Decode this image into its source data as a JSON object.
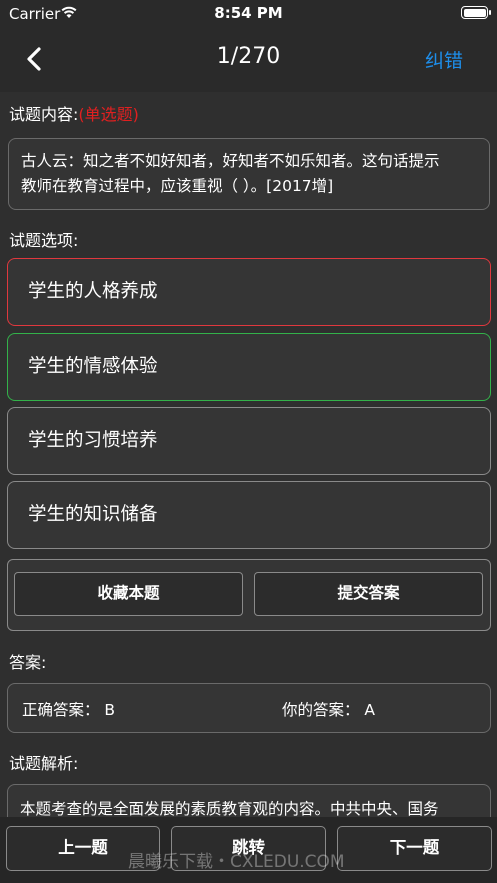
{
  "status_bar": {
    "carrier": "Carrier",
    "time": "8:54 PM"
  },
  "nav": {
    "title": "1/270",
    "correct_label": "纠错"
  },
  "question": {
    "section_label": "试题内容:",
    "type_tag": "(单选题)",
    "text_line1": "古人云：知之者不如好知者，好知者不如乐知者。这句话提示",
    "text_line2": "教师在教育过程中，应该重视（ ）。[2017增]"
  },
  "options": {
    "section_label": "试题选项:",
    "items": [
      {
        "label": "学生的人格养成",
        "state": "wrong"
      },
      {
        "label": "学生的情感体验",
        "state": "right"
      },
      {
        "label": "学生的习惯培养",
        "state": "none"
      },
      {
        "label": "学生的知识储备",
        "state": "none"
      }
    ]
  },
  "actions": {
    "favorite_label": "收藏本题",
    "submit_label": "提交答案"
  },
  "answer": {
    "section_label": "答案:",
    "correct_text": "正确答案：  B",
    "yours_text": "你的答案：  A"
  },
  "analysis": {
    "section_label": "试题解析:",
    "text": "本题考查的是全面发展的素质教育观的内容。中共中央、国务"
  },
  "bottom": {
    "prev_label": "上一题",
    "jump_label": "跳转",
    "next_label": "下一题"
  },
  "watermark": "晨曦乐下载・CXLEDU.COM",
  "colors": {
    "accent": "#1e8eea",
    "wrong": "#e0383e",
    "right": "#33b24a",
    "tag": "#e02020"
  }
}
